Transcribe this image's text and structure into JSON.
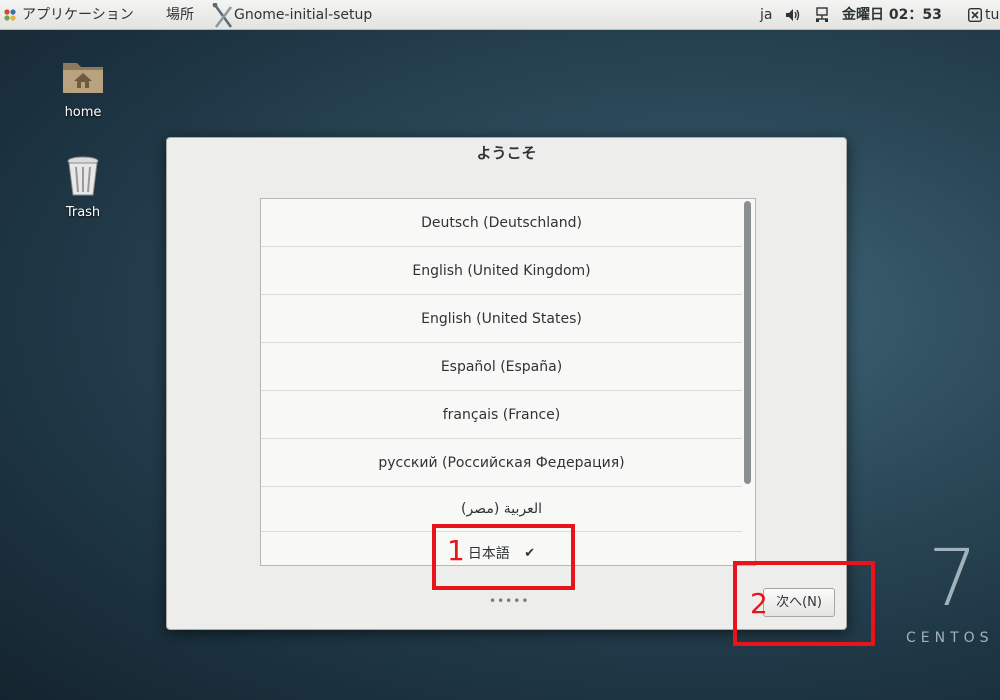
{
  "topbar": {
    "applications": "アプリケーション",
    "places": "場所",
    "app_name": "Gnome-initial-setup",
    "input_lang": "ja",
    "clock": "金曜日 02：53",
    "user_partial": "tu"
  },
  "desktop": {
    "icons": [
      {
        "label": "home"
      },
      {
        "label": "Trash"
      }
    ],
    "brand_number": "7",
    "brand_text": "CENTOS"
  },
  "dialog": {
    "title": "ようこそ",
    "languages": [
      {
        "label": "Deutsch (Deutschland)",
        "selected": false
      },
      {
        "label": "English (United Kingdom)",
        "selected": false
      },
      {
        "label": "English (United States)",
        "selected": false
      },
      {
        "label": "Español (España)",
        "selected": false
      },
      {
        "label": "français (France)",
        "selected": false
      },
      {
        "label": "русский (Российская Федерация)",
        "selected": false
      },
      {
        "label": "العربية (مصر)",
        "selected": false
      },
      {
        "label": "日本語",
        "selected": true
      }
    ],
    "check_mark": "✔",
    "page_dots": "•••••",
    "next_button": "次へ(N)"
  },
  "annotations": [
    {
      "label": "1"
    },
    {
      "label": "2"
    }
  ],
  "colors": {
    "annotation": "#e8141b",
    "dialog_bg": "#ededeb",
    "list_bg": "#f8f8f7"
  }
}
